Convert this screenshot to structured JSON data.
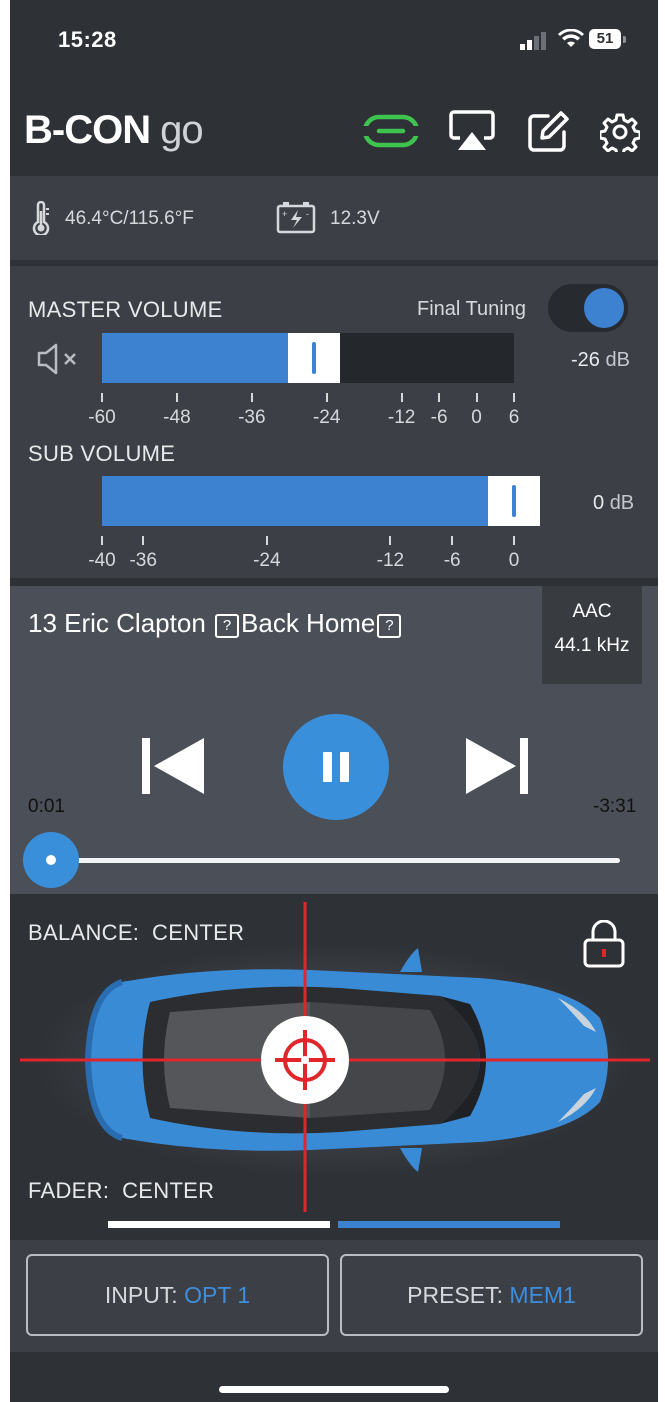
{
  "status_bar": {
    "time": "15:28",
    "battery": "51"
  },
  "header": {
    "title_main": "B-CON",
    "title_sub": "go",
    "icons": [
      "link-icon",
      "airplay-icon",
      "edit-icon",
      "gear-icon"
    ],
    "colors": {
      "link": "#3fc34f",
      "accent": "#3c82d0"
    }
  },
  "sensors": {
    "temperature": "46.4°C/115.6°F",
    "voltage": "12.3V"
  },
  "master_volume": {
    "label": "MASTER VOLUME",
    "final_tuning_label": "Final Tuning",
    "final_tuning_on": true,
    "value": -26,
    "unit": "dB",
    "value_text": "-26",
    "min": -60,
    "max": 6,
    "ticks": [
      "-60",
      "-48",
      "-36",
      "-24",
      "-12",
      "-6",
      "0",
      "6"
    ]
  },
  "sub_volume": {
    "label": "SUB VOLUME",
    "value": 0,
    "unit": "dB",
    "value_text": "0",
    "min": -40,
    "max": 0,
    "ticks": [
      "-40",
      "-36",
      "-24",
      "-12",
      "-6",
      "0"
    ]
  },
  "player": {
    "track_number": "13",
    "track_artist": "Eric Clapton",
    "track_title": "Back Home",
    "unknown_glyph": "?",
    "codec": "AAC",
    "sample_rate": "44.1 kHz",
    "elapsed": "0:01",
    "remaining": "-3:31",
    "progress_fraction": 0.005,
    "state": "playing"
  },
  "car": {
    "balance_label": "BALANCE:",
    "balance_value": "CENTER",
    "fader_label": "FADER:",
    "fader_value": "CENTER",
    "locked": false
  },
  "pages": {
    "count": 2,
    "active": 0
  },
  "bottom": {
    "input_label": "INPUT:",
    "input_value": "OPT 1",
    "preset_label": "PRESET:",
    "preset_value": "MEM1"
  }
}
